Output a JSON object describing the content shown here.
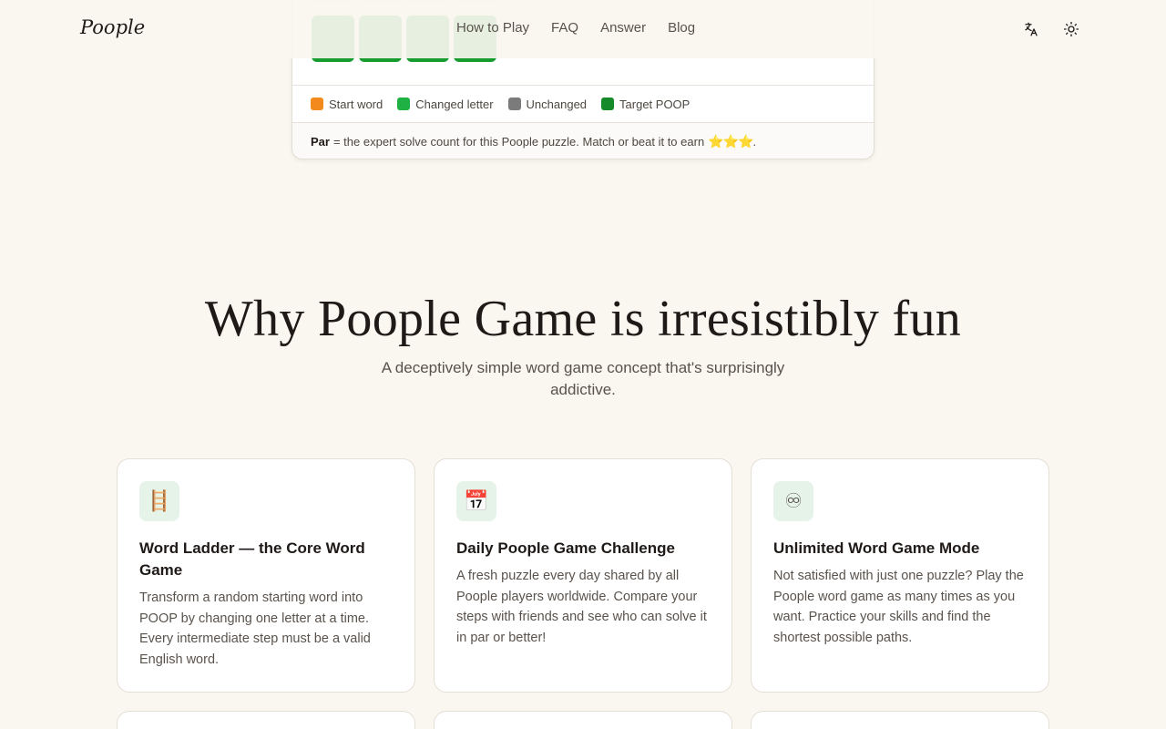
{
  "header": {
    "logo": "Poople",
    "nav": [
      "How to Play",
      "FAQ",
      "Answer",
      "Blog"
    ]
  },
  "game_card": {
    "legend": [
      {
        "label": "Start word",
        "color": "#f28a1e"
      },
      {
        "label": "Changed letter",
        "color": "#1fb144"
      },
      {
        "label": "Unchanged",
        "color": "#7b7b7b"
      },
      {
        "label": "Target POOP",
        "color": "#158a2a"
      }
    ],
    "par_label": "Par",
    "par_text": "= the expert solve count for this Poople puzzle. Match or beat it to earn",
    "par_stars": "⭐⭐⭐",
    "par_end": "."
  },
  "hero": {
    "title": "Why Poople Game is irresistibly fun",
    "subtitle": "A deceptively simple word game concept that's surprisingly addictive."
  },
  "features": [
    {
      "icon": "ladder-icon",
      "glyph": "🪜",
      "title": "Word Ladder — the Core Word Game",
      "text": "Transform a random starting word into POOP by changing one letter at a time. Every intermediate step must be a valid English word."
    },
    {
      "icon": "calendar-icon",
      "glyph": "📅",
      "title": "Daily Poople Game Challenge",
      "text": "A fresh puzzle every day shared by all Poople players worldwide. Compare your steps with friends and see who can solve it in par or better!"
    },
    {
      "icon": "infinity-icon",
      "glyph": "♾",
      "title": "Unlimited Word Game Mode",
      "text": "Not satisfied with just one puzzle? Play the Poople word game as many times as you want. Practice your skills and find the shortest possible paths."
    }
  ]
}
